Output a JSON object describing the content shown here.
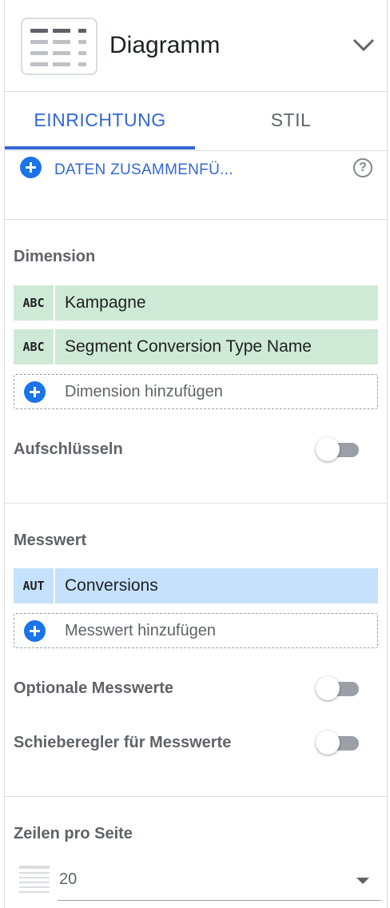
{
  "header": {
    "title": "Diagramm",
    "icon": "table-chart-icon",
    "dropdown_icon": "chevron-down-icon"
  },
  "tabs": [
    {
      "label": "EINRICHTUNG",
      "active": true
    },
    {
      "label": "STIL",
      "active": false
    }
  ],
  "blend": {
    "label": "DATEN ZUSAMMENFÜ...",
    "help_icon": "help-circle-icon"
  },
  "dimension": {
    "title": "Dimension",
    "items": [
      {
        "type": "ABC",
        "name": "Kampagne"
      },
      {
        "type": "ABC",
        "name": "Segment Conversion Type Name"
      }
    ],
    "add_label": "Dimension hinzufügen",
    "drilldown": {
      "label": "Aufschlüsseln",
      "on": false
    }
  },
  "metric": {
    "title": "Messwert",
    "items": [
      {
        "type": "AUT",
        "name": "Conversions"
      }
    ],
    "add_label": "Messwert hinzufügen",
    "optional": {
      "label": "Optionale Messwerte",
      "on": false
    },
    "slider": {
      "label": "Schieberegler für Messwerte",
      "on": false
    }
  },
  "rows_per_page": {
    "title": "Zeilen pro Seite",
    "value": "20"
  },
  "colors": {
    "accent": "#3367d6",
    "dimension_chip": "#ceead6",
    "metric_chip": "#c5e1fb",
    "add_button": "#1a73e8"
  }
}
